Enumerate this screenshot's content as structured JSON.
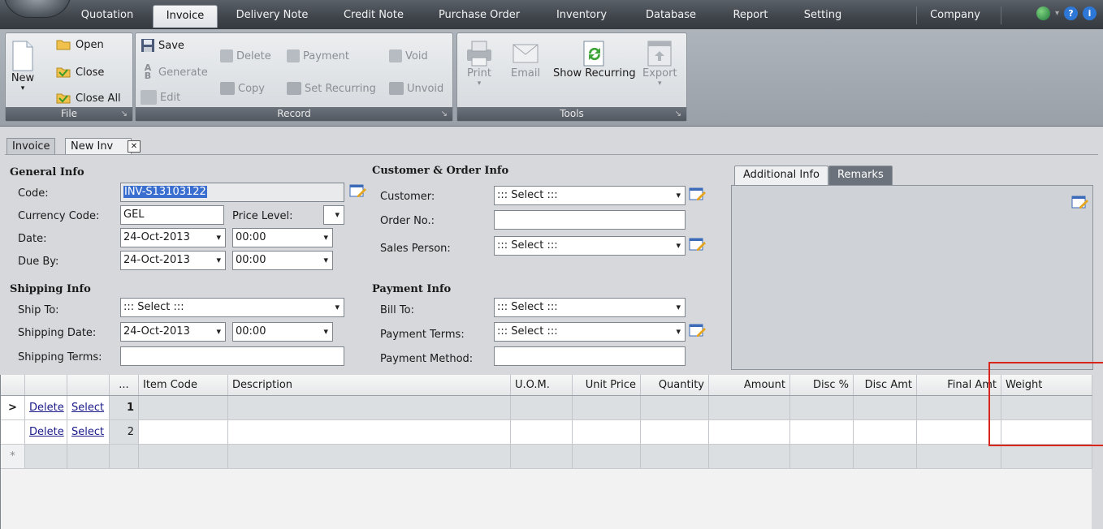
{
  "menu": {
    "tabs": [
      "Quotation",
      "Invoice",
      "Delivery Note",
      "Credit Note",
      "Purchase Order",
      "Inventory",
      "Database",
      "Report",
      "Setting"
    ],
    "company": "Company",
    "active_tab": "Invoice"
  },
  "ribbon": {
    "file": {
      "caption": "File",
      "new": "New",
      "open": "Open",
      "close": "Close",
      "close_all": "Close All"
    },
    "record": {
      "caption": "Record",
      "save": "Save",
      "generate": "Generate",
      "edit": "Edit",
      "delete": "Delete",
      "copy": "Copy",
      "payment": "Payment",
      "set_recurring": "Set Recurring",
      "void": "Void",
      "unvoid": "Unvoid"
    },
    "tools": {
      "caption": "Tools",
      "print": "Print",
      "email": "Email",
      "show_recurring": "Show Recurring",
      "export": "Export"
    }
  },
  "doc_tabs": {
    "invoice": "Invoice",
    "new_inv": "New Inv",
    "close": "✕"
  },
  "general": {
    "heading": "General Info",
    "code_label": "Code:",
    "code_value": "INV-S13103122",
    "currency_label": "Currency Code:",
    "currency_value": "GEL",
    "price_level_label": "Price Level:",
    "price_level_value": "",
    "date_label": "Date:",
    "date_value": "24-Oct-2013",
    "date_time": "00:00",
    "due_label": "Due By:",
    "due_value": "24-Oct-2013",
    "due_time": "00:00"
  },
  "shipping": {
    "heading": "Shipping Info",
    "ship_to_label": "Ship To:",
    "ship_to_value": "::: Select :::",
    "ship_date_label": "Shipping Date:",
    "ship_date_value": "24-Oct-2013",
    "ship_time": "00:00",
    "terms_label": "Shipping Terms:",
    "terms_value": ""
  },
  "customer": {
    "heading": "Customer & Order Info",
    "customer_label": "Customer:",
    "customer_value": "::: Select :::",
    "order_label": "Order No.:",
    "order_value": "",
    "sales_label": "Sales Person:",
    "sales_value": "::: Select :::"
  },
  "payment": {
    "heading": "Payment Info",
    "bill_label": "Bill To:",
    "bill_value": "::: Select :::",
    "terms_label": "Payment Terms:",
    "terms_value": "::: Select :::",
    "method_label": "Payment Method:",
    "method_value": ""
  },
  "side_tabs": {
    "additional": "Additional Info",
    "remarks": "Remarks"
  },
  "grid": {
    "headers": [
      "",
      "",
      "",
      "...",
      "Item Code",
      "Description",
      "U.O.M.",
      "Unit Price",
      "Quantity",
      "Amount",
      "Disc %",
      "Disc Amt",
      "Final Amt",
      "Weight"
    ],
    "rows": [
      {
        "indicator": ">",
        "delete": "Delete",
        "select": "Select",
        "num": "1"
      },
      {
        "indicator": "",
        "delete": "Delete",
        "select": "Select",
        "num": "2"
      }
    ],
    "new_row_marker": "*"
  },
  "colors": {
    "highlight": "#d9261c",
    "selection": "#3a6fd0"
  }
}
